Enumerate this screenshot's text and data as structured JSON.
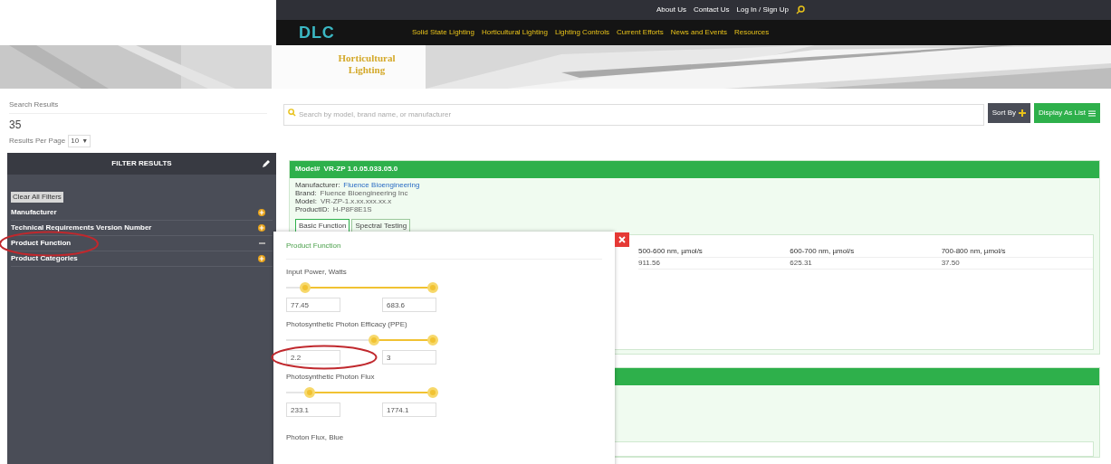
{
  "header": {
    "top_links": [
      "About Us",
      "Contact Us",
      "Log In / Sign Up"
    ],
    "logo": "DLC",
    "nav": [
      "Solid State Lighting",
      "Horticultural Lighting",
      "Lighting Controls",
      "Current Efforts",
      "News and Events",
      "Resources"
    ],
    "banner_title": "Horticultural Lighting"
  },
  "results": {
    "label": "Search Results",
    "count": "35",
    "per_page_label": "Results Per Page",
    "per_page": "10",
    "per_page_arrow": "▼"
  },
  "filters": {
    "title": "FILTER RESULTS",
    "clear": "Clear All Filters",
    "items": [
      {
        "label": "Manufacturer",
        "expanded": false
      },
      {
        "label": "Technical Requirements Version Number",
        "expanded": false
      },
      {
        "label": "Product Function",
        "expanded": true
      },
      {
        "label": "Product Categories",
        "expanded": false
      }
    ]
  },
  "search": {
    "placeholder": "Search by model, brand name, or manufacturer"
  },
  "buttons": {
    "sort": "Sort By",
    "display": "Display As List"
  },
  "card": {
    "model_label": "Model#",
    "model": "VR-ZP 1.0.05.033.05.0",
    "details": [
      {
        "label": "Manufacturer:",
        "value": "Fluence Bioengineering",
        "link": true
      },
      {
        "label": "Brand:",
        "value": "Fluence Bioengineering Inc",
        "link": false
      },
      {
        "label": "Model:",
        "value": "VR-ZP-1.x.xx.xxx.xx.x",
        "link": false
      },
      {
        "label": "ProductID:",
        "value": "H-P8F8E1S",
        "link": false
      }
    ],
    "tabs": [
      {
        "label": "Basic Function",
        "selected": true
      },
      {
        "label": "Spectral Testing",
        "selected": false
      }
    ],
    "table": {
      "columns": [
        "500-600 nm, µmol/s",
        "600-700 nm, µmol/s",
        "700-800 nm, µmol/s"
      ],
      "row": [
        "911.56",
        "625.31",
        "37.50"
      ]
    }
  },
  "modal": {
    "title": "Product Function",
    "sliders": [
      {
        "label": "Input Power, Watts",
        "thumbs": [
          {
            "level": 0.13
          },
          {
            "level": 1
          }
        ],
        "min": "77.45",
        "max": "683.6",
        "circled": false
      },
      {
        "label": "Photosynthetic Photon Efficacy (PPE)",
        "thumbs": [
          {
            "level": 0.6
          },
          {
            "level": 1
          }
        ],
        "min": "2.2",
        "max": "3",
        "circled": true
      },
      {
        "label": "Photosynthetic Photon Flux",
        "thumbs": [
          {
            "level": 0.16
          },
          {
            "level": 1
          }
        ],
        "min": "233.1",
        "max": "1774.1",
        "circled": false
      }
    ],
    "next_label": "Photon Flux, Blue"
  }
}
